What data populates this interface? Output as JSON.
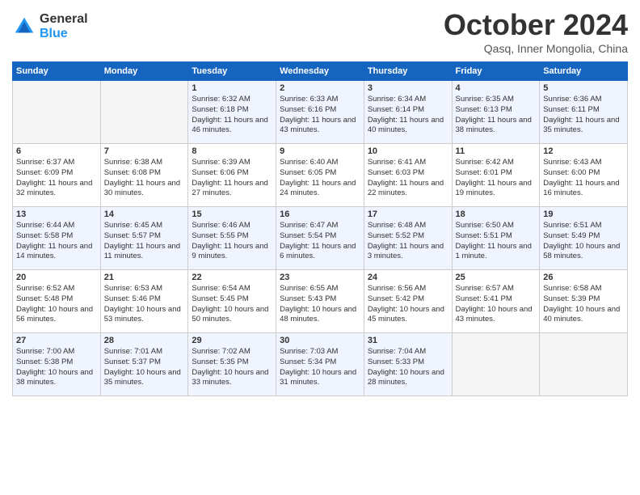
{
  "header": {
    "logo_general": "General",
    "logo_blue": "Blue",
    "month_title": "October 2024",
    "location": "Qasq, Inner Mongolia, China"
  },
  "days_of_week": [
    "Sunday",
    "Monday",
    "Tuesday",
    "Wednesday",
    "Thursday",
    "Friday",
    "Saturday"
  ],
  "weeks": [
    [
      {
        "day": "",
        "sunrise": "",
        "sunset": "",
        "daylight": ""
      },
      {
        "day": "",
        "sunrise": "",
        "sunset": "",
        "daylight": ""
      },
      {
        "day": "1",
        "sunrise": "Sunrise: 6:32 AM",
        "sunset": "Sunset: 6:18 PM",
        "daylight": "Daylight: 11 hours and 46 minutes."
      },
      {
        "day": "2",
        "sunrise": "Sunrise: 6:33 AM",
        "sunset": "Sunset: 6:16 PM",
        "daylight": "Daylight: 11 hours and 43 minutes."
      },
      {
        "day": "3",
        "sunrise": "Sunrise: 6:34 AM",
        "sunset": "Sunset: 6:14 PM",
        "daylight": "Daylight: 11 hours and 40 minutes."
      },
      {
        "day": "4",
        "sunrise": "Sunrise: 6:35 AM",
        "sunset": "Sunset: 6:13 PM",
        "daylight": "Daylight: 11 hours and 38 minutes."
      },
      {
        "day": "5",
        "sunrise": "Sunrise: 6:36 AM",
        "sunset": "Sunset: 6:11 PM",
        "daylight": "Daylight: 11 hours and 35 minutes."
      }
    ],
    [
      {
        "day": "6",
        "sunrise": "Sunrise: 6:37 AM",
        "sunset": "Sunset: 6:09 PM",
        "daylight": "Daylight: 11 hours and 32 minutes."
      },
      {
        "day": "7",
        "sunrise": "Sunrise: 6:38 AM",
        "sunset": "Sunset: 6:08 PM",
        "daylight": "Daylight: 11 hours and 30 minutes."
      },
      {
        "day": "8",
        "sunrise": "Sunrise: 6:39 AM",
        "sunset": "Sunset: 6:06 PM",
        "daylight": "Daylight: 11 hours and 27 minutes."
      },
      {
        "day": "9",
        "sunrise": "Sunrise: 6:40 AM",
        "sunset": "Sunset: 6:05 PM",
        "daylight": "Daylight: 11 hours and 24 minutes."
      },
      {
        "day": "10",
        "sunrise": "Sunrise: 6:41 AM",
        "sunset": "Sunset: 6:03 PM",
        "daylight": "Daylight: 11 hours and 22 minutes."
      },
      {
        "day": "11",
        "sunrise": "Sunrise: 6:42 AM",
        "sunset": "Sunset: 6:01 PM",
        "daylight": "Daylight: 11 hours and 19 minutes."
      },
      {
        "day": "12",
        "sunrise": "Sunrise: 6:43 AM",
        "sunset": "Sunset: 6:00 PM",
        "daylight": "Daylight: 11 hours and 16 minutes."
      }
    ],
    [
      {
        "day": "13",
        "sunrise": "Sunrise: 6:44 AM",
        "sunset": "Sunset: 5:58 PM",
        "daylight": "Daylight: 11 hours and 14 minutes."
      },
      {
        "day": "14",
        "sunrise": "Sunrise: 6:45 AM",
        "sunset": "Sunset: 5:57 PM",
        "daylight": "Daylight: 11 hours and 11 minutes."
      },
      {
        "day": "15",
        "sunrise": "Sunrise: 6:46 AM",
        "sunset": "Sunset: 5:55 PM",
        "daylight": "Daylight: 11 hours and 9 minutes."
      },
      {
        "day": "16",
        "sunrise": "Sunrise: 6:47 AM",
        "sunset": "Sunset: 5:54 PM",
        "daylight": "Daylight: 11 hours and 6 minutes."
      },
      {
        "day": "17",
        "sunrise": "Sunrise: 6:48 AM",
        "sunset": "Sunset: 5:52 PM",
        "daylight": "Daylight: 11 hours and 3 minutes."
      },
      {
        "day": "18",
        "sunrise": "Sunrise: 6:50 AM",
        "sunset": "Sunset: 5:51 PM",
        "daylight": "Daylight: 11 hours and 1 minute."
      },
      {
        "day": "19",
        "sunrise": "Sunrise: 6:51 AM",
        "sunset": "Sunset: 5:49 PM",
        "daylight": "Daylight: 10 hours and 58 minutes."
      }
    ],
    [
      {
        "day": "20",
        "sunrise": "Sunrise: 6:52 AM",
        "sunset": "Sunset: 5:48 PM",
        "daylight": "Daylight: 10 hours and 56 minutes."
      },
      {
        "day": "21",
        "sunrise": "Sunrise: 6:53 AM",
        "sunset": "Sunset: 5:46 PM",
        "daylight": "Daylight: 10 hours and 53 minutes."
      },
      {
        "day": "22",
        "sunrise": "Sunrise: 6:54 AM",
        "sunset": "Sunset: 5:45 PM",
        "daylight": "Daylight: 10 hours and 50 minutes."
      },
      {
        "day": "23",
        "sunrise": "Sunrise: 6:55 AM",
        "sunset": "Sunset: 5:43 PM",
        "daylight": "Daylight: 10 hours and 48 minutes."
      },
      {
        "day": "24",
        "sunrise": "Sunrise: 6:56 AM",
        "sunset": "Sunset: 5:42 PM",
        "daylight": "Daylight: 10 hours and 45 minutes."
      },
      {
        "day": "25",
        "sunrise": "Sunrise: 6:57 AM",
        "sunset": "Sunset: 5:41 PM",
        "daylight": "Daylight: 10 hours and 43 minutes."
      },
      {
        "day": "26",
        "sunrise": "Sunrise: 6:58 AM",
        "sunset": "Sunset: 5:39 PM",
        "daylight": "Daylight: 10 hours and 40 minutes."
      }
    ],
    [
      {
        "day": "27",
        "sunrise": "Sunrise: 7:00 AM",
        "sunset": "Sunset: 5:38 PM",
        "daylight": "Daylight: 10 hours and 38 minutes."
      },
      {
        "day": "28",
        "sunrise": "Sunrise: 7:01 AM",
        "sunset": "Sunset: 5:37 PM",
        "daylight": "Daylight: 10 hours and 35 minutes."
      },
      {
        "day": "29",
        "sunrise": "Sunrise: 7:02 AM",
        "sunset": "Sunset: 5:35 PM",
        "daylight": "Daylight: 10 hours and 33 minutes."
      },
      {
        "day": "30",
        "sunrise": "Sunrise: 7:03 AM",
        "sunset": "Sunset: 5:34 PM",
        "daylight": "Daylight: 10 hours and 31 minutes."
      },
      {
        "day": "31",
        "sunrise": "Sunrise: 7:04 AM",
        "sunset": "Sunset: 5:33 PM",
        "daylight": "Daylight: 10 hours and 28 minutes."
      },
      {
        "day": "",
        "sunrise": "",
        "sunset": "",
        "daylight": ""
      },
      {
        "day": "",
        "sunrise": "",
        "sunset": "",
        "daylight": ""
      }
    ]
  ]
}
